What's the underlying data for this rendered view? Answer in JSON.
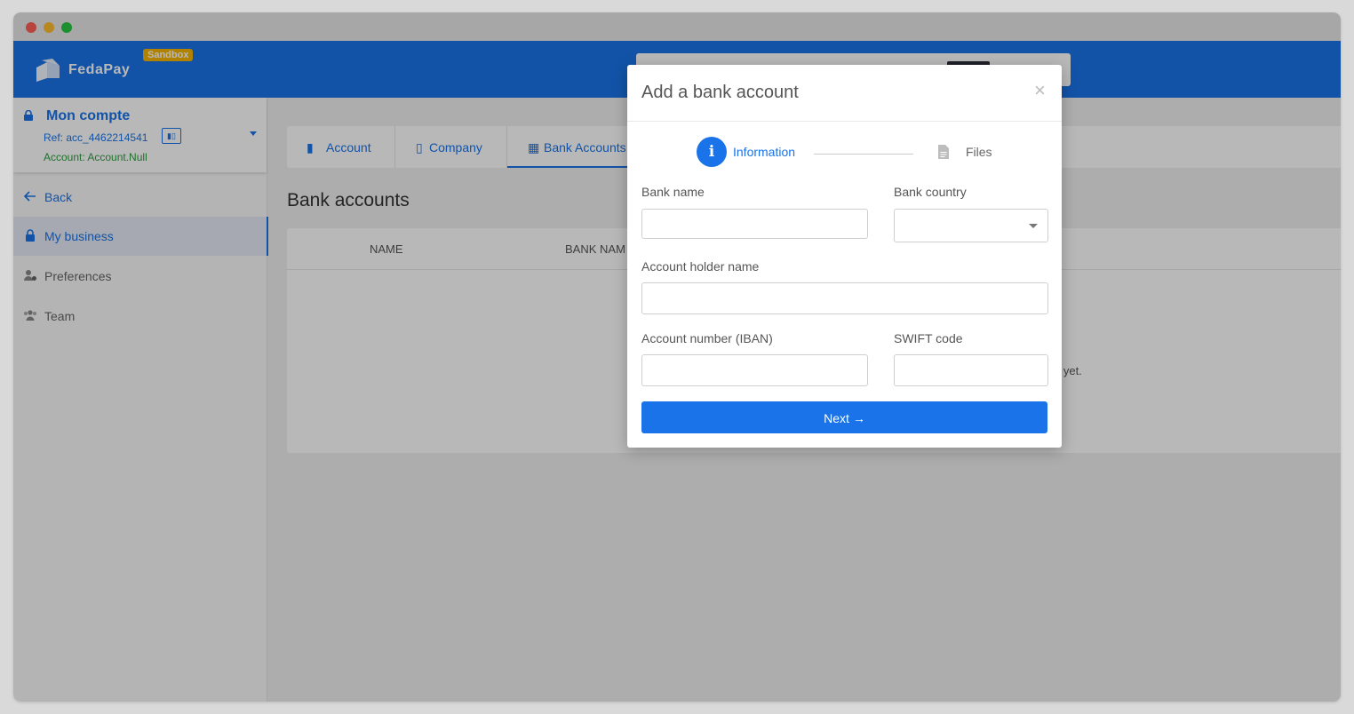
{
  "brand": {
    "name": "FedaPay",
    "badge": "Sandbox"
  },
  "account": {
    "title": "Mon compte",
    "ref": "Ref: acc_4462214541",
    "status": "Account: Account.Null"
  },
  "sidebar": {
    "items": [
      {
        "label": "Back",
        "icon": "arrow-left-icon"
      },
      {
        "label": "My business",
        "icon": "lock-icon"
      },
      {
        "label": "Preferences",
        "icon": "user-gear-icon"
      },
      {
        "label": "Team",
        "icon": "users-icon"
      }
    ]
  },
  "tabs": [
    {
      "label": "Account",
      "icon": "account-icon"
    },
    {
      "label": "Company",
      "icon": "building-icon"
    },
    {
      "label": "Bank Accounts",
      "icon": "bank-icon"
    }
  ],
  "page": {
    "title": "Bank accounts",
    "columns": [
      "NAME",
      "BANK NAM"
    ],
    "empty_fragment": "e yet."
  },
  "modal": {
    "title": "Add a bank account",
    "close": "×",
    "steps": [
      {
        "label": "Information",
        "icon": "info-icon",
        "glyph": "i"
      },
      {
        "label": "Files",
        "icon": "file-icon"
      }
    ],
    "fields": {
      "bank_name": {
        "label": "Bank name",
        "value": ""
      },
      "bank_country": {
        "label": "Bank country",
        "value": ""
      },
      "holder_name": {
        "label": "Account holder name",
        "value": ""
      },
      "account_number": {
        "label": "Account number (IBAN)",
        "value": ""
      },
      "swift": {
        "label": "SWIFT code",
        "value": ""
      }
    },
    "next_label": "Next →"
  },
  "colors": {
    "primary": "#1a73e8",
    "sandbox": "#f5b400",
    "success": "#2e9d3e"
  }
}
